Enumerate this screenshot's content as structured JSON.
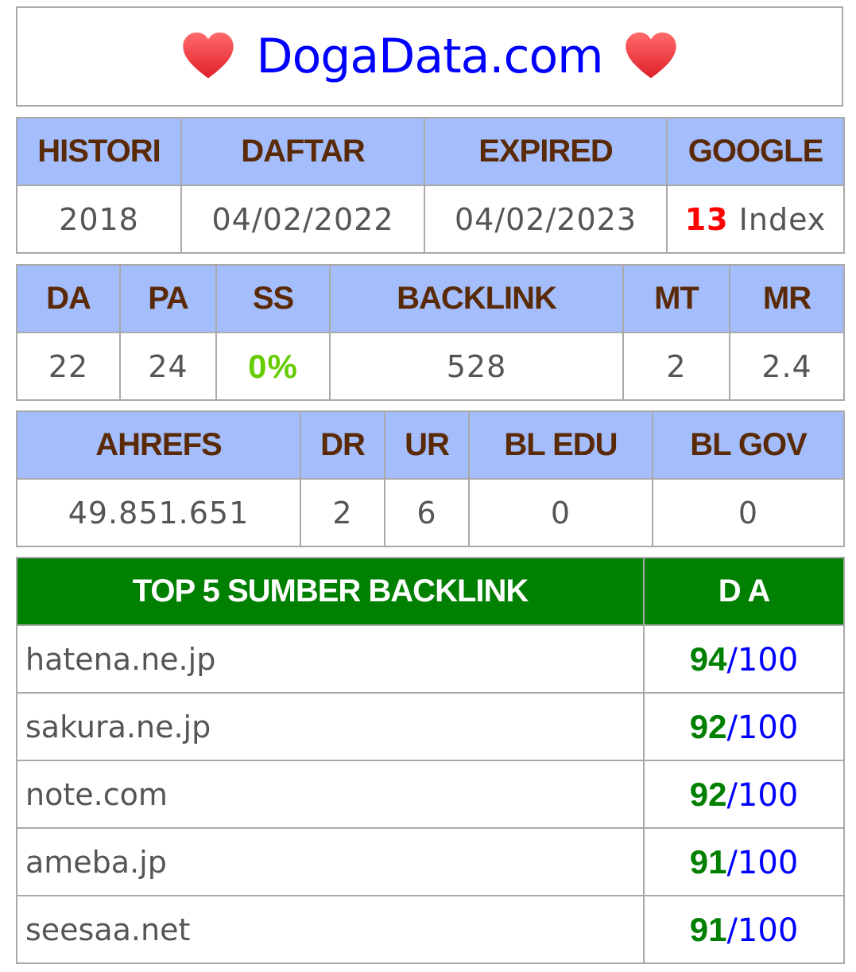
{
  "site_title": "DogaData.com",
  "table1": {
    "headers": [
      "HISTORI",
      "DAFTAR",
      "EXPIRED",
      "GOOGLE"
    ],
    "histori": "2018",
    "daftar": "04/02/2022",
    "expired": "04/02/2023",
    "google_count": "13",
    "google_suffix": "Index"
  },
  "table2": {
    "headers": [
      "DA",
      "PA",
      "SS",
      "BACKLINK",
      "MT",
      "MR"
    ],
    "values": [
      "22",
      "24",
      "0%",
      "528",
      "2",
      "2.4"
    ]
  },
  "table3": {
    "headers": [
      "AHREFS",
      "DR",
      "UR",
      "BL EDU",
      "BL GOV"
    ],
    "values": [
      "49.851.651",
      "2",
      "6",
      "0",
      "0"
    ]
  },
  "top_backlinks": {
    "header_source": "TOP 5 SUMBER BACKLINK",
    "header_da": "D A",
    "separator": "/",
    "rows": [
      {
        "site": "hatena.ne.jp",
        "score": "94",
        "max": "100"
      },
      {
        "site": "sakura.ne.jp",
        "score": "92",
        "max": "100"
      },
      {
        "site": "note.com",
        "score": "92",
        "max": "100"
      },
      {
        "site": "ameba.jp",
        "score": "91",
        "max": "100"
      },
      {
        "site": "seesaa.net",
        "score": "91",
        "max": "100"
      }
    ]
  },
  "colors": {
    "title": "#0000ff",
    "header_bg": "#a4bdfc",
    "header_text": "#5a2a07",
    "top_header_bg": "#008000",
    "score": "#008000",
    "max": "#0000ff",
    "index_count": "#ff0000",
    "ss_value": "#66cc00"
  },
  "icons": {
    "left": "heart-icon",
    "right": "heart-icon"
  }
}
